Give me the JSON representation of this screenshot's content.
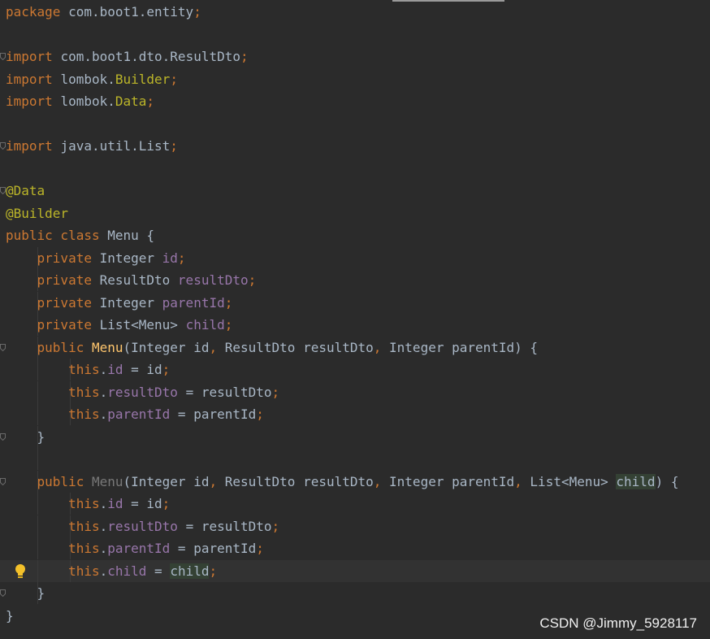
{
  "editor": {
    "lines": [
      [
        {
          "t": "package ",
          "c": "kw"
        },
        {
          "t": "com.boot1.entity",
          "c": "pl"
        },
        {
          "t": ";",
          "c": "kw"
        }
      ],
      [],
      [
        {
          "t": "import ",
          "c": "kw"
        },
        {
          "t": "com.boot1.dto.ResultDto",
          "c": "pl"
        },
        {
          "t": ";",
          "c": "kw"
        }
      ],
      [
        {
          "t": "import ",
          "c": "kw"
        },
        {
          "t": "lombok.",
          "c": "pl"
        },
        {
          "t": "Builder",
          "c": "ann"
        },
        {
          "t": ";",
          "c": "kw"
        }
      ],
      [
        {
          "t": "import ",
          "c": "kw"
        },
        {
          "t": "lombok.",
          "c": "pl"
        },
        {
          "t": "Data",
          "c": "ann"
        },
        {
          "t": ";",
          "c": "kw"
        }
      ],
      [],
      [
        {
          "t": "import ",
          "c": "kw"
        },
        {
          "t": "java.util.List",
          "c": "pl"
        },
        {
          "t": ";",
          "c": "kw"
        }
      ],
      [],
      [
        {
          "t": "@Data",
          "c": "ann"
        }
      ],
      [
        {
          "t": "@Builder",
          "c": "ann"
        }
      ],
      [
        {
          "t": "public class ",
          "c": "kw"
        },
        {
          "t": "Menu {",
          "c": "pl"
        }
      ],
      [
        {
          "t": "    private ",
          "c": "kw"
        },
        {
          "t": "Integer ",
          "c": "pl"
        },
        {
          "t": "id",
          "c": "fld"
        },
        {
          "t": ";",
          "c": "kw"
        }
      ],
      [
        {
          "t": "    private ",
          "c": "kw"
        },
        {
          "t": "ResultDto ",
          "c": "pl"
        },
        {
          "t": "resultDto",
          "c": "fld"
        },
        {
          "t": ";",
          "c": "kw"
        }
      ],
      [
        {
          "t": "    private ",
          "c": "kw"
        },
        {
          "t": "Integer ",
          "c": "pl"
        },
        {
          "t": "parentId",
          "c": "fld"
        },
        {
          "t": ";",
          "c": "kw"
        }
      ],
      [
        {
          "t": "    private ",
          "c": "kw"
        },
        {
          "t": "List<Menu> ",
          "c": "pl"
        },
        {
          "t": "child",
          "c": "fld"
        },
        {
          "t": ";",
          "c": "kw"
        }
      ],
      [
        {
          "t": "    public ",
          "c": "kw"
        },
        {
          "t": "Menu",
          "c": "fn"
        },
        {
          "t": "(Integer id",
          "c": "pl"
        },
        {
          "t": ", ",
          "c": "kw"
        },
        {
          "t": "ResultDto resultDto",
          "c": "pl"
        },
        {
          "t": ", ",
          "c": "kw"
        },
        {
          "t": "Integer parentId) {",
          "c": "pl"
        }
      ],
      [
        {
          "t": "        this",
          "c": "kw"
        },
        {
          "t": ".",
          "c": "pl"
        },
        {
          "t": "id",
          "c": "fld"
        },
        {
          "t": " = id",
          "c": "pl"
        },
        {
          "t": ";",
          "c": "kw"
        }
      ],
      [
        {
          "t": "        this",
          "c": "kw"
        },
        {
          "t": ".",
          "c": "pl"
        },
        {
          "t": "resultDto",
          "c": "fld"
        },
        {
          "t": " = resultDto",
          "c": "pl"
        },
        {
          "t": ";",
          "c": "kw"
        }
      ],
      [
        {
          "t": "        this",
          "c": "kw"
        },
        {
          "t": ".",
          "c": "pl"
        },
        {
          "t": "parentId",
          "c": "fld"
        },
        {
          "t": " = parentId",
          "c": "pl"
        },
        {
          "t": ";",
          "c": "kw"
        }
      ],
      [
        {
          "t": "    }",
          "c": "pl"
        }
      ],
      [],
      [
        {
          "t": "    public ",
          "c": "kw"
        },
        {
          "t": "Menu",
          "c": "unused"
        },
        {
          "t": "(Integer id",
          "c": "pl"
        },
        {
          "t": ", ",
          "c": "kw"
        },
        {
          "t": "ResultDto resultDto",
          "c": "pl"
        },
        {
          "t": ", ",
          "c": "kw"
        },
        {
          "t": "Integer parentId",
          "c": "pl"
        },
        {
          "t": ", ",
          "c": "kw"
        },
        {
          "t": "List<Menu> ",
          "c": "pl"
        },
        {
          "t": "child",
          "c": "pl hl"
        },
        {
          "t": ") {",
          "c": "pl"
        }
      ],
      [
        {
          "t": "        this",
          "c": "kw"
        },
        {
          "t": ".",
          "c": "pl"
        },
        {
          "t": "id",
          "c": "fld"
        },
        {
          "t": " = id",
          "c": "pl"
        },
        {
          "t": ";",
          "c": "kw"
        }
      ],
      [
        {
          "t": "        this",
          "c": "kw"
        },
        {
          "t": ".",
          "c": "pl"
        },
        {
          "t": "resultDto",
          "c": "fld"
        },
        {
          "t": " = resultDto",
          "c": "pl"
        },
        {
          "t": ";",
          "c": "kw"
        }
      ],
      [
        {
          "t": "        this",
          "c": "kw"
        },
        {
          "t": ".",
          "c": "pl"
        },
        {
          "t": "parentId",
          "c": "fld"
        },
        {
          "t": " = parentId",
          "c": "pl"
        },
        {
          "t": ";",
          "c": "kw"
        }
      ],
      [
        {
          "t": "        this",
          "c": "kw"
        },
        {
          "t": ".",
          "c": "pl"
        },
        {
          "t": "child",
          "c": "fld"
        },
        {
          "t": " = ",
          "c": "pl"
        },
        {
          "t": "child",
          "c": "pl hl"
        },
        {
          "t": ";",
          "c": "kw"
        }
      ],
      [
        {
          "t": "    }",
          "c": "pl"
        }
      ],
      [
        {
          "t": "}",
          "c": "pl"
        }
      ]
    ],
    "current_line": 25,
    "fold_markers": [
      2,
      6,
      8,
      15,
      19,
      21,
      26
    ],
    "intention_bulb_line": 25,
    "indent_guides": {
      "level1_lines": [
        11,
        12,
        13,
        14,
        15,
        16,
        17,
        18,
        19,
        20,
        21,
        22,
        23,
        24,
        25,
        26
      ],
      "level2_lines": [
        16,
        17,
        18,
        22,
        23,
        24,
        25
      ]
    }
  },
  "colors": {
    "background": "#2b2b2b",
    "keyword": "#cc7832",
    "annotation": "#bbb529",
    "field": "#9876aa",
    "method": "#ffc66d",
    "plain": "#a9b7c6",
    "unused": "#787878",
    "highlight": "#344134",
    "current_line": "#323232"
  },
  "watermark": {
    "text": "CSDN @Jimmy_5928117"
  }
}
